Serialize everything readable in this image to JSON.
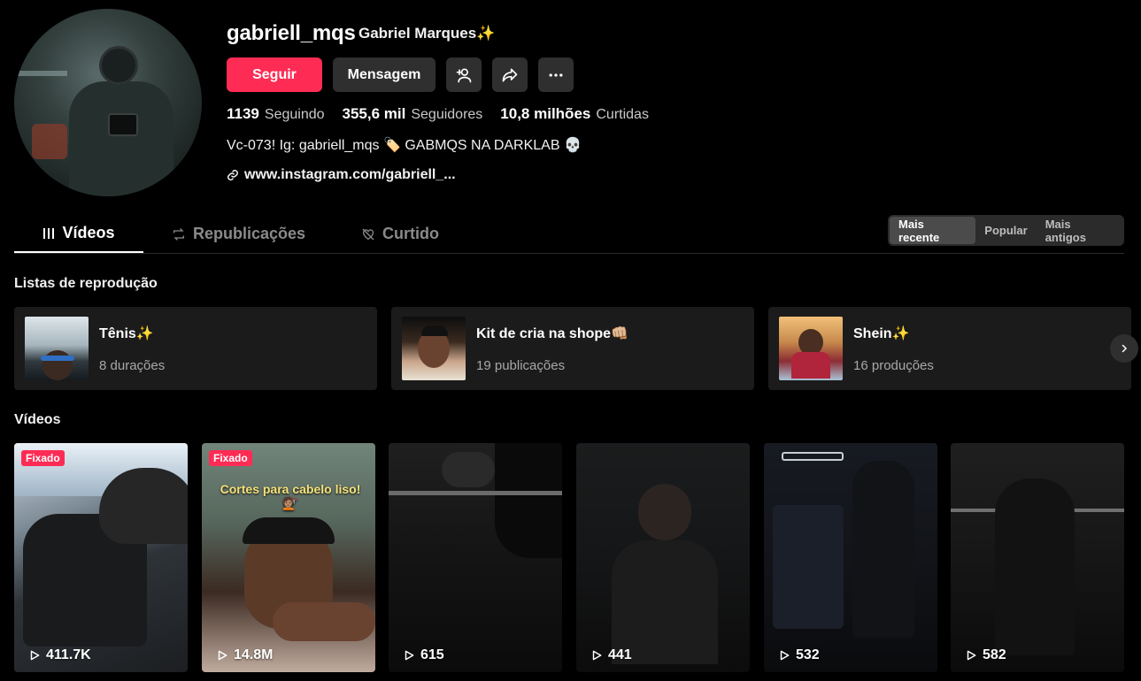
{
  "profile": {
    "username": "gabriell_mqs",
    "display_name": "Gabriel Marques✨",
    "follow_label": "Seguir",
    "message_label": "Mensagem",
    "stats": [
      {
        "value": "1139",
        "label": "Seguindo"
      },
      {
        "value": "355,6 mil",
        "label": "Seguidores"
      },
      {
        "value": "10,8 milhões",
        "label": "Curtidas"
      }
    ],
    "bio": "Vc-073! Ig: gabriell_mqs 🏷️ GABMQS NA DARKLAB 💀",
    "link": "www.instagram.com/gabriell_..."
  },
  "tabs": [
    {
      "label": "Vídeos"
    },
    {
      "label": "Republicações"
    },
    {
      "label": "Curtido"
    }
  ],
  "sort": {
    "options": [
      "Mais recente",
      "Popular",
      "Mais antigos"
    ],
    "selected": "Mais recente"
  },
  "playlists": {
    "title": "Listas de reprodução",
    "items": [
      {
        "name": "Tênis✨",
        "count": "8 durações"
      },
      {
        "name": "Kit de cria na shope👊🏼",
        "count": "19 publicações"
      },
      {
        "name": "Shein✨",
        "count": "16 produções"
      }
    ]
  },
  "videos": {
    "title": "Vídeos",
    "pinned_label": "Fixado",
    "items": [
      {
        "views": "411.7K",
        "pinned": true
      },
      {
        "views": "14.8M",
        "pinned": true,
        "caption": "Cortes para cabelo liso! 💇🏽"
      },
      {
        "views": "615"
      },
      {
        "views": "441"
      },
      {
        "views": "532"
      },
      {
        "views": "582"
      }
    ]
  },
  "colors": {
    "accent": "#fe2c55",
    "background": "#000000",
    "button_dark": "#2f2f2f",
    "card": "#1b1b1b"
  }
}
